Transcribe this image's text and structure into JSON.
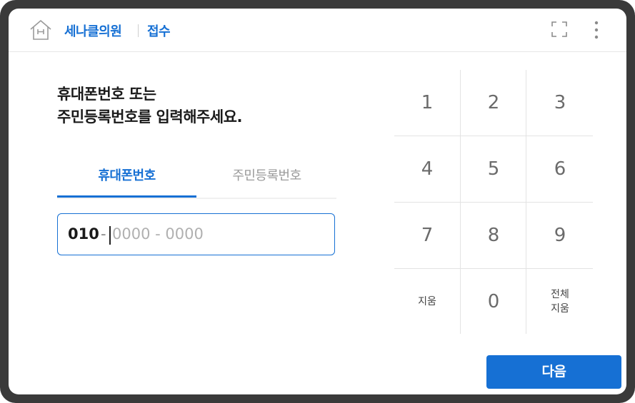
{
  "header": {
    "clinic_name": "세나클의원",
    "section": "접수"
  },
  "instruction": {
    "line1": "휴대폰번호 또는",
    "line2": "주민등록번호를 입력해주세요."
  },
  "tabs": [
    {
      "label": "휴대폰번호",
      "active": true
    },
    {
      "label": "주민등록번호",
      "active": false
    }
  ],
  "phone_input": {
    "prefix": "010",
    "separator": "-",
    "placeholder": "0000 - 0000"
  },
  "keypad": {
    "digits": [
      "1",
      "2",
      "3",
      "4",
      "5",
      "6",
      "7",
      "8",
      "9"
    ],
    "delete_label": "지움",
    "zero": "0",
    "clear_all_line1": "전체",
    "clear_all_line2": "지움"
  },
  "next_button": "다음",
  "colors": {
    "accent": "#1670d4",
    "frame": "#3a3a3a"
  },
  "icons": [
    "home-icon",
    "fullscreen-icon",
    "more-vertical-icon"
  ]
}
